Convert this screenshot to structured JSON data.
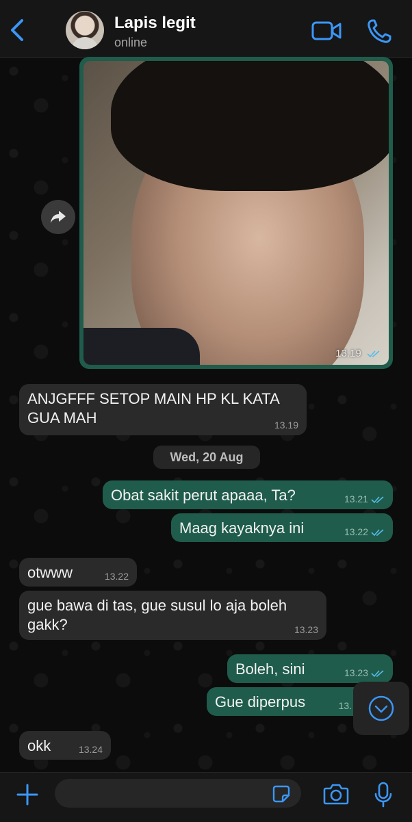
{
  "header": {
    "back_label": "",
    "contact_name": "Lapis legit",
    "contact_status": "online",
    "icons": [
      "chevron-left-icon",
      "video-call-icon",
      "phone-icon"
    ],
    "accent_color": "#3b97f7"
  },
  "messages": [
    {
      "type": "image",
      "direction": "out",
      "time": "13.19",
      "read": true
    },
    {
      "type": "text",
      "direction": "in",
      "text": "ANJGFFF SETOP MAIN HP KL KATA GUA MAH",
      "time": "13.19"
    },
    {
      "type": "date",
      "text": "Wed, 20 Aug"
    },
    {
      "type": "text",
      "direction": "out",
      "text": "Obat sakit perut apaaa, Ta?",
      "time": "13.21",
      "read": true
    },
    {
      "type": "text",
      "direction": "out",
      "text": "Maag kayaknya ini",
      "time": "13.22",
      "read": true
    },
    {
      "type": "text",
      "direction": "in",
      "text": "otwww",
      "time": "13.22"
    },
    {
      "type": "text",
      "direction": "in",
      "text": "gue bawa di tas, gue susul lo aja boleh gakk?",
      "time": "13.23"
    },
    {
      "type": "text",
      "direction": "out",
      "text": "Boleh, sini",
      "time": "13.23",
      "read": true
    },
    {
      "type": "text",
      "direction": "out",
      "text": "Gue diperpus",
      "time": "13.",
      "read": true
    },
    {
      "type": "text",
      "direction": "in",
      "text": "okk",
      "time": "13.24"
    }
  ],
  "composer": {
    "placeholder": "",
    "icons": [
      "plus-icon",
      "sticker-icon",
      "camera-icon",
      "microphone-icon"
    ]
  },
  "colors": {
    "outgoing_bubble": "#1f5c4b",
    "incoming_bubble": "#2a2a2a",
    "read_ticks": "#53bdeb"
  }
}
